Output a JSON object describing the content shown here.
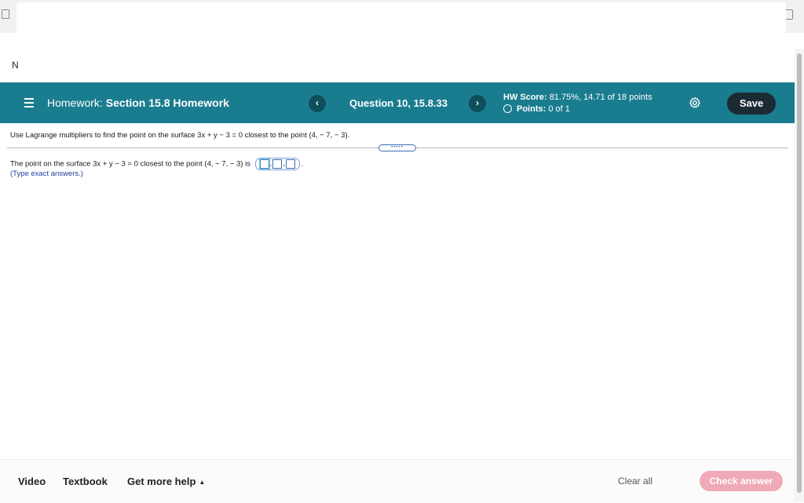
{
  "stub_letter": "N",
  "header": {
    "homework_label": "Homework:",
    "homework_name": "Section 15.8 Homework",
    "prev_symbol": "‹",
    "next_symbol": "›",
    "question_label": "Question 10, 15.8.33",
    "hw_score_label": "HW Score:",
    "hw_score_value": "81.75%, 14.71 of 18 points",
    "points_label": "Points:",
    "points_value": "0 of 1",
    "save_label": "Save"
  },
  "question": {
    "prompt": "Use Lagrange multipliers to find the point on the surface 3x + y − 3 = 0 closest to the point (4, − 7, − 3).",
    "handle_dots": "•••••",
    "answer_prefix": "The point on the surface 3x + y − 3 = 0 closest to the point (4, − 7, − 3) is",
    "answer_separator": ",",
    "answer_suffix": ".",
    "hint": "(Type exact answers.)"
  },
  "footer": {
    "video_label": "Video",
    "textbook_label": "Textbook",
    "help_label": "Get more help",
    "help_caret": "▲",
    "clear_all_label": "Clear all",
    "check_answer_label": "Check answer"
  },
  "colors": {
    "header_bg": "#1a7c8f",
    "save_bg": "#1c2b33",
    "check_answer_bg": "#f0a9b6",
    "hint_text": "#1f3d9c"
  },
  "icons": {
    "menu": "hamburger-icon",
    "settings": "gear-icon",
    "points_status": "circle-outline-icon"
  }
}
